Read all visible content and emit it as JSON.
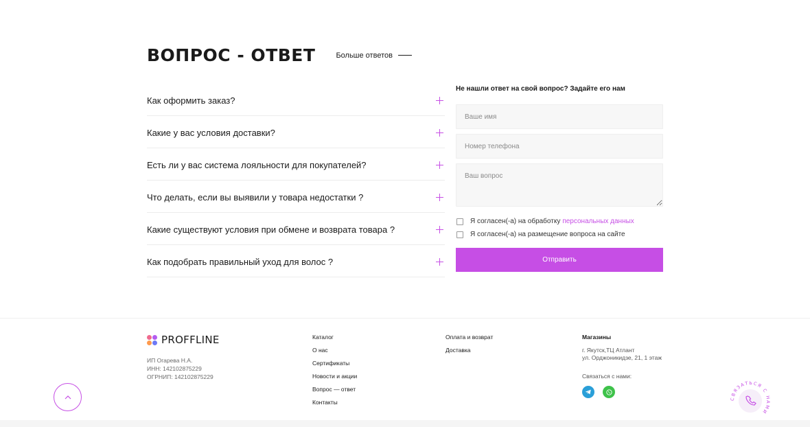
{
  "faq": {
    "title": "ВОПРОС - ОТВЕТ",
    "more_label": "Больше ответов",
    "items": [
      "Как оформить заказ?",
      "Какие у вас условия доставки?",
      "Есть ли у вас система лояльности для покупателей?",
      "Что делать, если вы выявили у товара недостатки ?",
      "Какие существуют условия при обмене и возврата товара ?",
      "Как подобрать правильный уход для волос ?"
    ]
  },
  "form": {
    "title": "Не нашли ответ на свой вопрос? Задайте его нам",
    "name_placeholder": "Ваше имя",
    "phone_placeholder": "Номер телефона",
    "question_placeholder": "Ваш вопрос",
    "consent1_text": "Я согласен(-а) на обработку",
    "consent1_link": "персональных данных",
    "consent2_text": "Я согласен(-а) на размещение вопроса на сайте",
    "submit_label": "Отправить"
  },
  "footer": {
    "logo_text": "PROFFLINE",
    "legal": [
      "ИП Огарева Н.А.",
      "ИНН: 142102875229",
      "ОГРНИП: 142102875229"
    ],
    "col1": [
      "Каталог",
      "О нас",
      "Сертификаты",
      "Новости и акции",
      "Вопрос — ответ",
      "Контакты"
    ],
    "col2": [
      "Оплата и возврат",
      "Доставка"
    ],
    "stores_title": "Магазины",
    "stores_addr1": "г. Якутск,ТЦ Атлант",
    "stores_addr2": "ул. Орджоникидзе, 21, 1 этаж",
    "contact_label": "Связаться с нами:",
    "call_badge_text": "СВЯЗАТЬСЯ С НАМИ"
  },
  "colors": {
    "accent": "#c64ee5",
    "telegram": "#2a9fd8",
    "whatsapp": "#3ec24a"
  },
  "icons": {
    "faq_toggle": "plus-icon",
    "scroll": "chevron-up-icon",
    "call": "phone-icon"
  }
}
